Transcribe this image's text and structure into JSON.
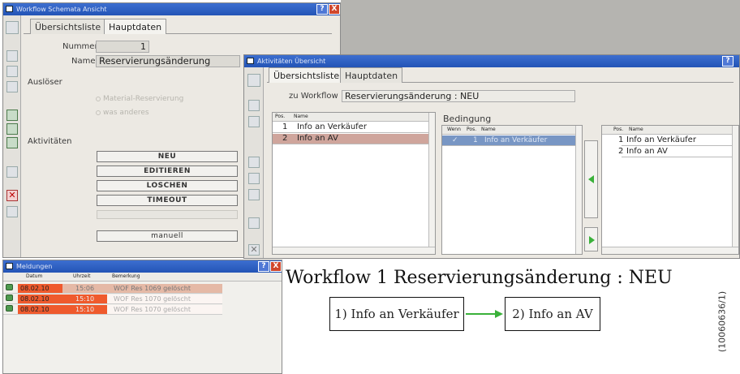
{
  "workflow_window": {
    "title": "Workflow Schemata Ansicht",
    "tabs": [
      "Übersichtsliste",
      "Hauptdaten"
    ],
    "nummer_label": "Nummer",
    "nummer_value": "1",
    "name_label": "Name",
    "name_value": "Reservierungsänderung",
    "ausloeser_label": "Auslöser",
    "ausloeser_options": [
      "Material-Reservierung",
      "was anderes"
    ],
    "aktivitaeten_label": "Aktivitäten",
    "buttons": {
      "neu": "NEU",
      "editieren": "EDITIEREN",
      "loeschen": "LOSCHEN",
      "timeout": "TIMEOUT",
      "manuell": "manuell"
    },
    "help_glyph": "?",
    "close_glyph": "X"
  },
  "activities_window": {
    "title": "Aktivitäten Übersicht",
    "tabs": [
      "Übersichtsliste",
      "Hauptdaten"
    ],
    "zu_workflow_label": "zu Workflow",
    "zu_workflow_value": "Reservierungsänderung : NEU",
    "bedingung_label": "Bedingung",
    "left_list": {
      "headers": [
        "Pos.",
        "Name"
      ],
      "rows": [
        {
          "pos": "1",
          "name": "Info an Verkäufer"
        },
        {
          "pos": "2",
          "name": "Info an AV"
        }
      ]
    },
    "condition_list": {
      "headers": [
        "Wenn",
        "Pos.",
        "Name"
      ],
      "rows": [
        {
          "wenn": "✓",
          "pos": "1",
          "name": "Info an Verkäufer"
        }
      ]
    },
    "right_list": {
      "headers": [
        "Pos.",
        "Name"
      ],
      "rows": [
        {
          "pos": "1",
          "name": "Info an Verkäufer"
        },
        {
          "pos": "2",
          "name": "Info an AV"
        }
      ]
    },
    "help_glyph": "?"
  },
  "messages_window": {
    "title": "Meldungen",
    "headers": [
      "Datum",
      "Uhrzeit",
      "Bemerkung"
    ],
    "rows": [
      {
        "datum": "08.02.10",
        "uhrzeit": "15:06",
        "bemerkung": "WOF Res 1069 gelöscht"
      },
      {
        "datum": "08.02.10",
        "uhrzeit": "15:10",
        "bemerkung": "WOF Res 1070 gelöscht"
      },
      {
        "datum": "08.02.10",
        "uhrzeit": "15:10",
        "bemerkung": "WOF Res 1070 gelöscht"
      }
    ],
    "help_glyph": "?",
    "close_glyph": "X"
  },
  "diagram": {
    "title": "Workflow 1 Reservierungsänderung : NEU",
    "step1": "1) Info an Verkäufer",
    "step2": "2) Info an AV"
  },
  "figure_id": "(10060636/1)",
  "colors": {
    "titlebar": "#2a5bbf",
    "selected_row": "#cfa59c",
    "message_red": "#ef5a2d",
    "message_pink": "#e5b9a6",
    "arrow_green": "#3ab13a",
    "background_grey": "#b6b5b1"
  }
}
